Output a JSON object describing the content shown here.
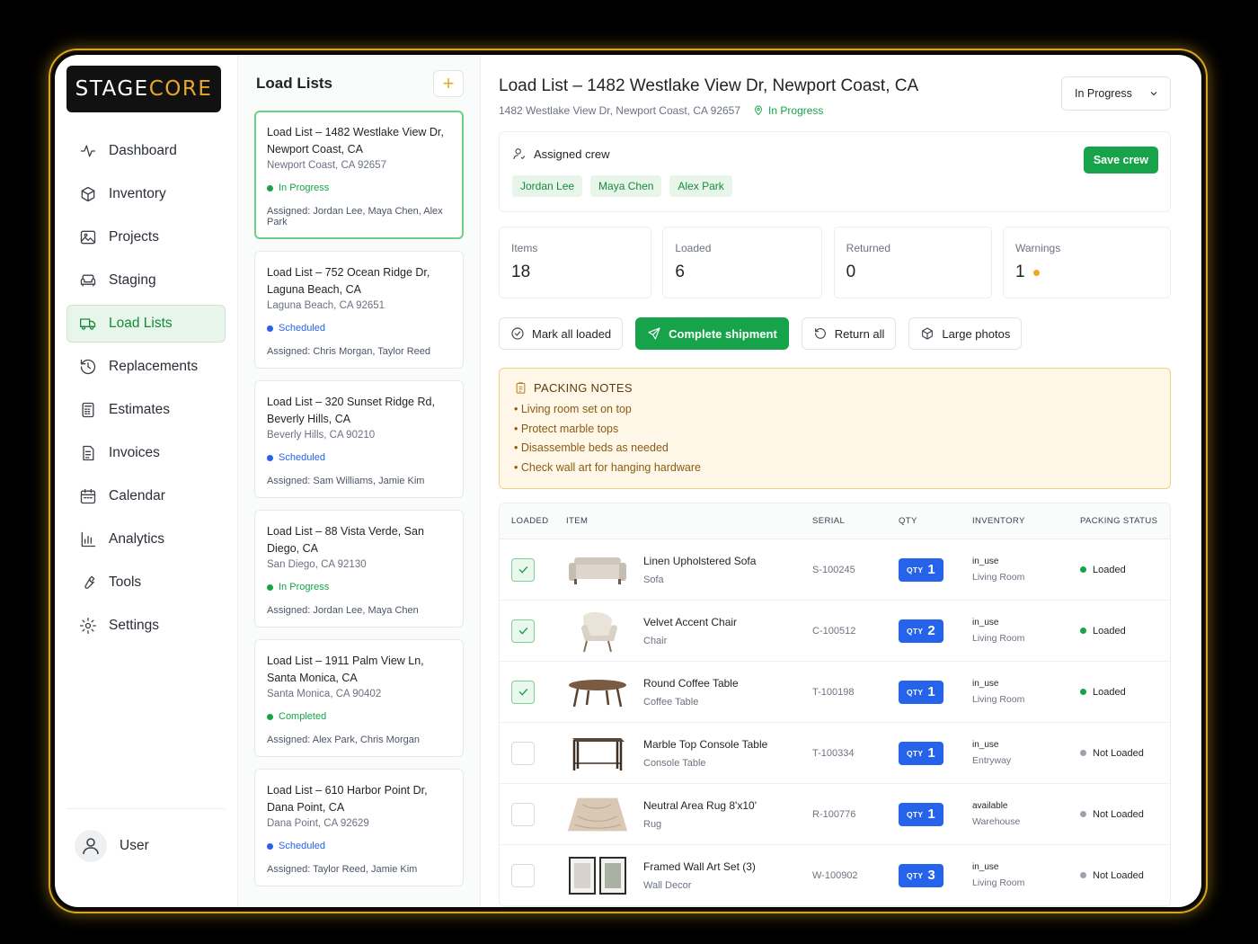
{
  "brand": {
    "stage": "STAGE",
    "core": "CORE",
    "accent": "#e8a825"
  },
  "sidebar": {
    "items": [
      {
        "label": "Dashboard",
        "icon": "activity-icon"
      },
      {
        "label": "Inventory",
        "icon": "box-icon"
      },
      {
        "label": "Projects",
        "icon": "image-icon"
      },
      {
        "label": "Staging",
        "icon": "sofa-icon"
      },
      {
        "label": "Load Lists",
        "icon": "truck-icon",
        "active": true
      },
      {
        "label": "Replacements",
        "icon": "history-icon"
      },
      {
        "label": "Estimates",
        "icon": "calculator-icon"
      },
      {
        "label": "Invoices",
        "icon": "invoice-icon"
      },
      {
        "label": "Calendar",
        "icon": "calendar-icon"
      },
      {
        "label": "Analytics",
        "icon": "bar-chart-icon"
      },
      {
        "label": "Tools",
        "icon": "wrench-icon"
      },
      {
        "label": "Settings",
        "icon": "gear-icon"
      }
    ],
    "user": "User"
  },
  "list": {
    "title": "Load Lists",
    "add": "+",
    "cards": [
      {
        "title": "Load List – 1482 Westlake View Dr, Newport Coast, CA",
        "addr": "Newport Coast, CA 92657",
        "status": "In Progress",
        "kind": "progress",
        "assigned": "Assigned: Jordan Lee, Maya Chen, Alex Park"
      },
      {
        "title": "Load List – 752 Ocean Ridge Dr, Laguna Beach, CA",
        "addr": "Laguna Beach, CA 92651",
        "status": "Scheduled",
        "kind": "scheduled",
        "assigned": "Assigned: Chris Morgan, Taylor Reed"
      },
      {
        "title": "Load List – 320 Sunset Ridge Rd, Beverly Hills, CA",
        "addr": "Beverly Hills, CA 90210",
        "status": "Scheduled",
        "kind": "scheduled",
        "assigned": "Assigned: Sam Williams, Jamie Kim"
      },
      {
        "title": "Load List – 88 Vista Verde, San Diego, CA",
        "addr": "San Diego, CA 92130",
        "status": "In Progress",
        "kind": "progress",
        "assigned": "Assigned: Jordan Lee, Maya Chen"
      },
      {
        "title": "Load List – 1911 Palm View Ln, Santa Monica, CA",
        "addr": "Santa Monica, CA 90402",
        "status": "Completed",
        "kind": "completed",
        "assigned": "Assigned: Alex Park, Chris Morgan"
      },
      {
        "title": "Load List – 610 Harbor Point Dr, Dana Point, CA",
        "addr": "Dana Point, CA 92629",
        "status": "Scheduled",
        "kind": "scheduled",
        "assigned": "Assigned: Taylor Reed, Jamie Kim"
      }
    ]
  },
  "main": {
    "title": "Load List – 1482 Westlake View Dr, Newport Coast, CA",
    "address": "1482 Westlake View Dr, Newport Coast, CA 92657",
    "status": "In Progress",
    "status_select": "In Progress",
    "crew": {
      "label": "Assigned crew",
      "members": [
        "Jordan Lee",
        "Maya Chen",
        "Alex Park"
      ],
      "save": "Save crew"
    },
    "stats": [
      {
        "label": "Items",
        "value": "18"
      },
      {
        "label": "Loaded",
        "value": "6"
      },
      {
        "label": "Returned",
        "value": "0"
      },
      {
        "label": "Warnings",
        "value": "1"
      }
    ],
    "actions": {
      "mark": "Mark all loaded",
      "complete": "Complete shipment",
      "return": "Return all",
      "photos": "Large photos"
    },
    "notes": {
      "title": "PACKING NOTES",
      "items": [
        "Living room set on top",
        "Protect marble tops",
        "Disassemble beds as needed",
        "Check wall art for hanging hardware"
      ]
    },
    "table": {
      "headers": {
        "loaded": "LOADED",
        "item": "ITEM",
        "serial": "SERIAL",
        "qty": "QTY",
        "inventory": "INVENTORY",
        "packing": "PACKING STATUS"
      },
      "qty_label": "QTY",
      "rows": [
        {
          "checked": true,
          "name": "Linen Upholstered Sofa",
          "cat": "Sofa",
          "serial": "S-100245",
          "qty": "1",
          "inv": "in_use",
          "loc": "Living Room",
          "status": "Loaded",
          "thumb": "sofa-thumbnail"
        },
        {
          "checked": true,
          "name": "Velvet Accent Chair",
          "cat": "Chair",
          "serial": "C-100512",
          "qty": "2",
          "inv": "in_use",
          "loc": "Living Room",
          "status": "Loaded",
          "thumb": "chair-thumbnail"
        },
        {
          "checked": true,
          "name": "Round Coffee Table",
          "cat": "Coffee Table",
          "serial": "T-100198",
          "qty": "1",
          "inv": "in_use",
          "loc": "Living Room",
          "status": "Loaded",
          "thumb": "coffee-table-thumbnail"
        },
        {
          "checked": false,
          "name": "Marble Top Console Table",
          "cat": "Console Table",
          "serial": "T-100334",
          "qty": "1",
          "inv": "in_use",
          "loc": "Entryway",
          "status": "Not Loaded",
          "thumb": "console-table-thumbnail"
        },
        {
          "checked": false,
          "name": "Neutral Area Rug 8'x10'",
          "cat": "Rug",
          "serial": "R-100776",
          "qty": "1",
          "inv": "available",
          "loc": "Warehouse",
          "status": "Not Loaded",
          "thumb": "rug-thumbnail"
        },
        {
          "checked": false,
          "name": "Framed Wall Art Set (3)",
          "cat": "Wall Decor",
          "serial": "W-100902",
          "qty": "3",
          "inv": "in_use",
          "loc": "Living Room",
          "status": "Not Loaded",
          "thumb": "wall-art-thumbnail"
        }
      ]
    }
  }
}
